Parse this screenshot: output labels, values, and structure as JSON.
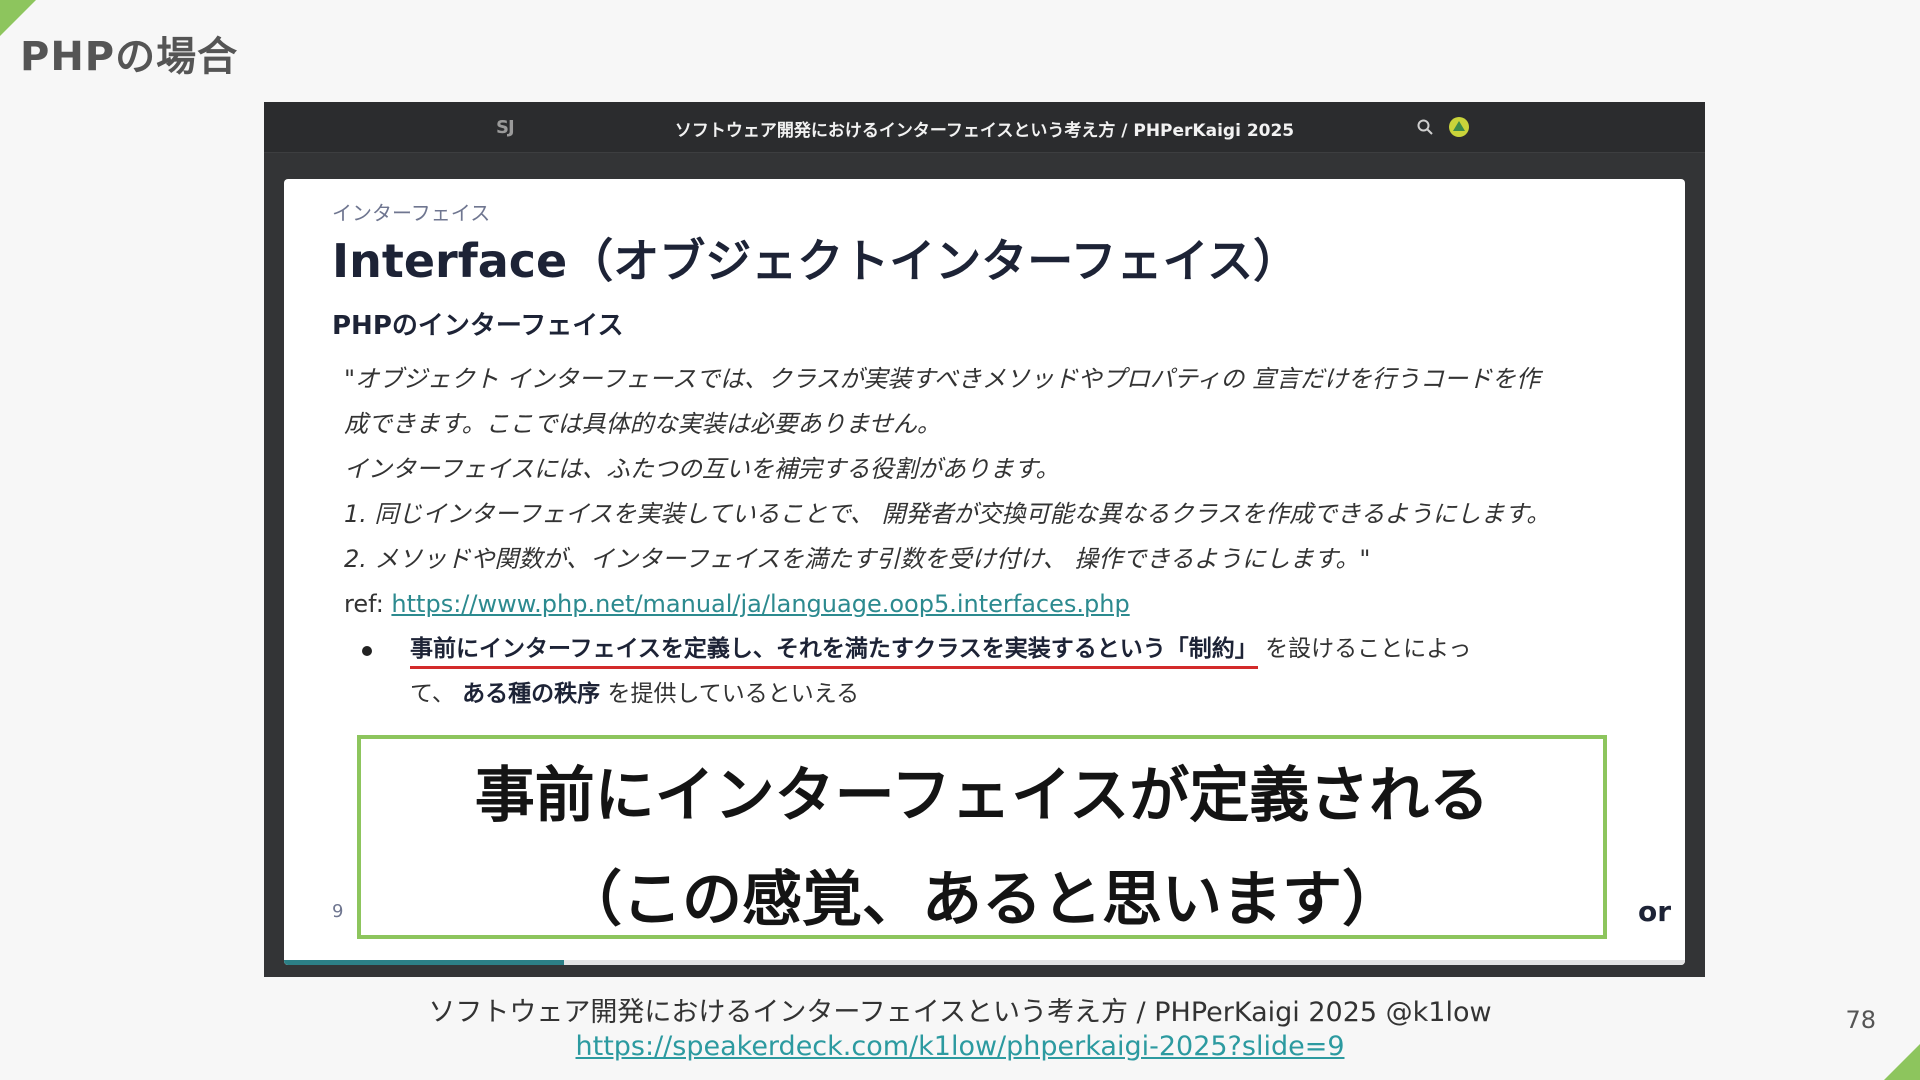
{
  "page": {
    "title": "PHPの場合",
    "page_number": "78",
    "accent_color": "#8dc55d"
  },
  "embed": {
    "logo": "SJ",
    "title": "ソフトウェア開発におけるインターフェイスという考え方 / PHPerKaigi 2025",
    "icons": [
      "search-icon",
      "avatar-icon"
    ]
  },
  "slide": {
    "kicker": "インターフェイス",
    "heading": "Interface（オブジェクトインターフェイス）",
    "subheading": "PHPのインターフェイス",
    "quote_lines": [
      "\"オブジェクト インターフェースでは、クラスが実装すべきメソッドやプロパティの 宣言だけを行うコードを作",
      "成できます。ここでは具体的な実装は必要ありません。",
      "インターフェイスには、ふたつの互いを補完する役割があります。",
      "1. 同じインターフェイスを実装していることで、 開発者が交換可能な異なるクラスを作成できるようにします。",
      "2. メソッドや関数が、インターフェイスを満たす引数を受け付け、 操作できるようにします。\""
    ],
    "ref_label": "ref: ",
    "ref_url": "https://www.php.net/manual/ja/language.oop5.interfaces.php",
    "bullet": {
      "strong1": "事前にインターフェイスを定義し、それを満たすクラスを実装するという「制約」",
      "text1": " を設けることによっ",
      "text2": "て、 ",
      "strong2": "ある種の秩序",
      "text3": " を提供しているといえる"
    },
    "number": "9",
    "brand": "or",
    "progress": 0.2
  },
  "overlay": {
    "line1": "事前にインターフェイスが定義される",
    "line2": "（この感覚、あると思います）"
  },
  "caption": {
    "text": "ソフトウェア開発におけるインターフェイスという考え方 / PHPerKaigi 2025 @k1low",
    "url": "https://speakerdeck.com/k1low/phperkaigi-2025?slide=9"
  }
}
